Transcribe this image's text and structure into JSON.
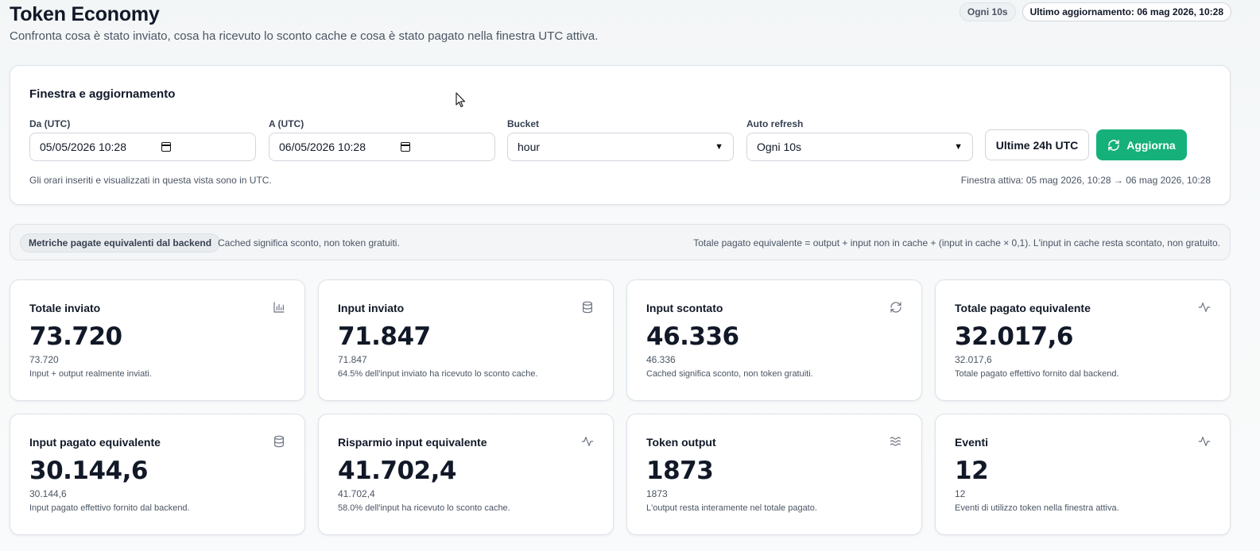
{
  "header": {
    "title": "Token Economy",
    "subtitle": "Confronta cosa è stato inviato, cosa ha ricevuto lo sconto cache e cosa è stato pagato nella finestra UTC attiva.",
    "refresh_badge": "Ogni 10s",
    "last_update": "Ultimo aggiornamento: 06 mag 2026, 10:28"
  },
  "filters": {
    "title": "Finestra e aggiornamento",
    "from_label": "Da (UTC)",
    "from_value": "05/05/2026 10:28",
    "to_label": "A (UTC)",
    "to_value": "06/05/2026 10:28",
    "bucket_label": "Bucket",
    "bucket_value": "hour",
    "auto_refresh_label": "Auto refresh",
    "auto_refresh_value": "Ogni 10s",
    "last24_button": "Ultime 24h UTC",
    "refresh_button": "Aggiorna",
    "note": "Gli orari inseriti e visualizzati in questa vista sono in UTC.",
    "active_window": "Finestra attiva: 05 mag 2026, 10:28 → 06 mag 2026, 10:28"
  },
  "info": {
    "badge": "Metriche pagate equivalenti dal backend",
    "text": "Cached significa sconto, non token gratuiti.",
    "formula": "Totale pagato equivalente = output + input non in cache + (input in cache × 0,1). L'input in cache resta scontato, non gratuito."
  },
  "metrics": [
    {
      "title": "Totale inviato",
      "value": "73.720",
      "sub": "73.720",
      "note": "Input + output realmente inviati.",
      "icon": "bar-chart-icon"
    },
    {
      "title": "Input inviato",
      "value": "71.847",
      "sub": "71.847",
      "note": "64.5% dell'input inviato ha ricevuto lo sconto cache.",
      "icon": "database-icon"
    },
    {
      "title": "Input scontato",
      "value": "46.336",
      "sub": "46.336",
      "note": "Cached significa sconto, non token gratuiti.",
      "icon": "refresh-icon"
    },
    {
      "title": "Totale pagato equivalente",
      "value": "32.017,6",
      "sub": "32.017,6",
      "note": "Totale pagato effettivo fornito dal backend.",
      "icon": "activity-icon"
    },
    {
      "title": "Input pagato equivalente",
      "value": "30.144,6",
      "sub": "30.144,6",
      "note": "Input pagato effettivo fornito dal backend.",
      "icon": "database-icon"
    },
    {
      "title": "Risparmio input equivalente",
      "value": "41.702,4",
      "sub": "41.702,4",
      "note": "58.0% dell'input ha ricevuto lo sconto cache.",
      "icon": "activity-icon"
    },
    {
      "title": "Token output",
      "value": "1873",
      "sub": "1873",
      "note": "L'output resta interamente nel totale pagato.",
      "icon": "waves-icon"
    },
    {
      "title": "Eventi",
      "value": "12",
      "sub": "12",
      "note": "Eventi di utilizzo token nella finestra attiva.",
      "icon": "activity-icon"
    }
  ],
  "colors": {
    "accent": "#16b07a"
  }
}
